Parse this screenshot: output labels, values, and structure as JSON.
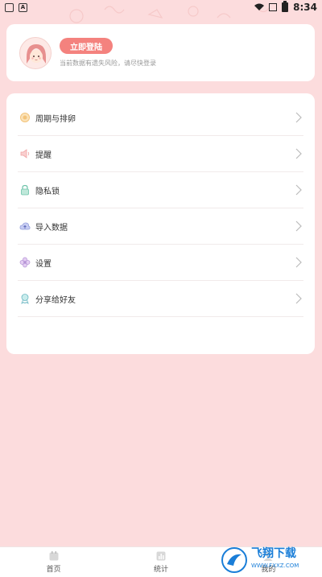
{
  "status_bar": {
    "time": "8:34",
    "left_badge": "A"
  },
  "profile": {
    "login_button": "立即登陆",
    "hint": "当前数据有遗失风险，请尽快登录"
  },
  "menu": {
    "items": [
      {
        "label": "周期与排卵",
        "icon": "sun-icon"
      },
      {
        "label": "提醒",
        "icon": "speaker-icon"
      },
      {
        "label": "隐私锁",
        "icon": "lock-icon"
      },
      {
        "label": "导入数据",
        "icon": "cloud-upload-icon"
      },
      {
        "label": "设置",
        "icon": "flower-icon"
      },
      {
        "label": "分享给好友",
        "icon": "ribbon-icon"
      }
    ]
  },
  "tabs": [
    {
      "label": "首页",
      "icon": "calendar-icon"
    },
    {
      "label": "统计",
      "icon": "chart-icon"
    },
    {
      "label": "我的",
      "icon": "profile-icon"
    }
  ],
  "watermark": {
    "title": "飞翔下载",
    "url": "WWW.FXXZ.COM"
  }
}
